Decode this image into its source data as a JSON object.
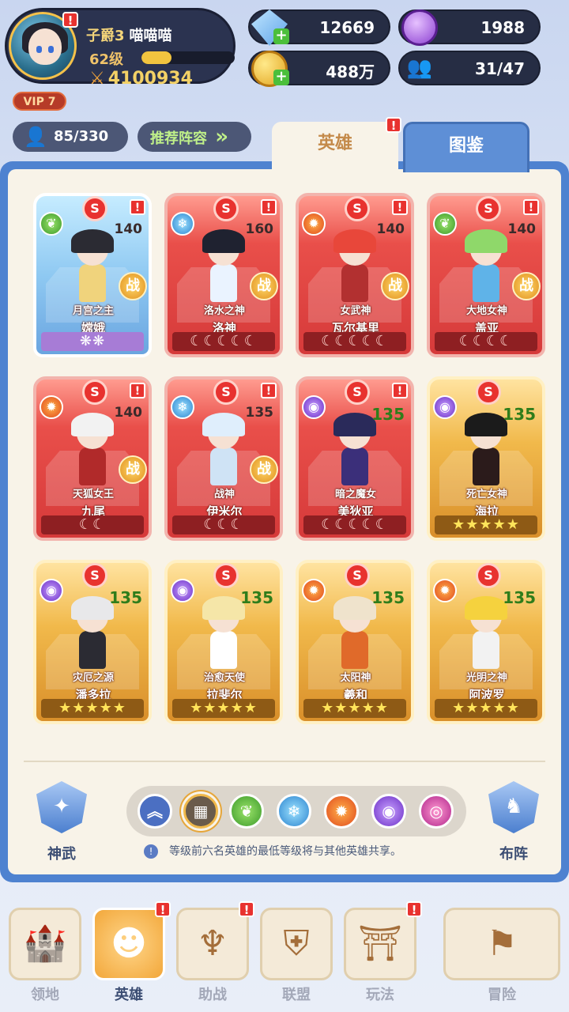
{
  "player": {
    "rank": "子爵3",
    "name": "喵喵喵",
    "level": "62级",
    "level_progress": 0.32,
    "power": "4100934",
    "vip": "VIP 7"
  },
  "resources": {
    "diamonds": "12669",
    "gold": "488万",
    "purple_currency": "1988",
    "friends": "31/47"
  },
  "roster": {
    "count": "85/330",
    "recommend_label": "推荐阵容",
    "recommend_arrows": "»"
  },
  "tabs": {
    "heroes": "英雄",
    "codex": "图鉴"
  },
  "cards": [
    {
      "title": "月宫之主",
      "name": "嫦娥",
      "level": "140",
      "element": "nature",
      "frame": "blue",
      "rating": "❋❋",
      "battle": "战"
    },
    {
      "title": "洛水之神",
      "name": "洛神",
      "level": "160",
      "element": "ice",
      "frame": "red",
      "rating": "☾☾☾☾☾",
      "battle": "战"
    },
    {
      "title": "女武神",
      "name": "瓦尔基里",
      "level": "140",
      "element": "fire",
      "frame": "red",
      "rating": "☾☾☾☾☾",
      "battle": "战"
    },
    {
      "title": "大地女神",
      "name": "盖亚",
      "level": "140",
      "element": "nature",
      "frame": "red",
      "rating": "☾☾☾☾",
      "battle": "战"
    },
    {
      "title": "天狐女王",
      "name": "九尾",
      "level": "140",
      "element": "fire",
      "frame": "red",
      "rating": "☾☾",
      "battle": "战"
    },
    {
      "title": "战神",
      "name": "伊米尔",
      "level": "135",
      "element": "ice",
      "frame": "red",
      "rating": "☾☾☾",
      "battle": "战"
    },
    {
      "title": "暗之魔女",
      "name": "美狄亚",
      "level": "135",
      "element": "dark",
      "frame": "red",
      "rating": "☾☾☾☾☾",
      "battle": ""
    },
    {
      "title": "死亡女神",
      "name": "海拉",
      "level": "135",
      "element": "dark",
      "frame": "gold",
      "rating": "★★★★★",
      "battle": ""
    },
    {
      "title": "灾厄之源",
      "name": "潘多拉",
      "level": "135",
      "element": "dark",
      "frame": "gold",
      "rating": "★★★★★",
      "battle": ""
    },
    {
      "title": "治愈天使",
      "name": "拉斐尔",
      "level": "135",
      "element": "dark",
      "frame": "gold",
      "rating": "★★★★★",
      "battle": ""
    },
    {
      "title": "太阳神",
      "name": "羲和",
      "level": "135",
      "element": "fire",
      "frame": "gold",
      "rating": "★★★★★",
      "battle": ""
    },
    {
      "title": "光明之神",
      "name": "阿波罗",
      "level": "135",
      "element": "fire",
      "frame": "gold",
      "rating": "★★★★★",
      "battle": ""
    }
  ],
  "side": {
    "weapon_label": "神武",
    "formation_label": "布阵"
  },
  "filters": [
    "all-ranks",
    "all",
    "nature",
    "ice",
    "fire",
    "dark",
    "chaos"
  ],
  "note": "等级前六名英雄的最低等级将与其他英雄共享。",
  "nav": [
    {
      "label": "领地",
      "icon": "castle-icon"
    },
    {
      "label": "英雄",
      "icon": "hero-icon"
    },
    {
      "label": "助战",
      "icon": "wings-icon"
    },
    {
      "label": "联盟",
      "icon": "banner-icon"
    },
    {
      "label": "玩法",
      "icon": "gate-icon"
    },
    {
      "label": "冒险",
      "icon": "flag-icon"
    }
  ],
  "colors": {
    "accent": "#4e82d0",
    "alert": "#e8322f",
    "level_bar": "#f1c43f"
  }
}
